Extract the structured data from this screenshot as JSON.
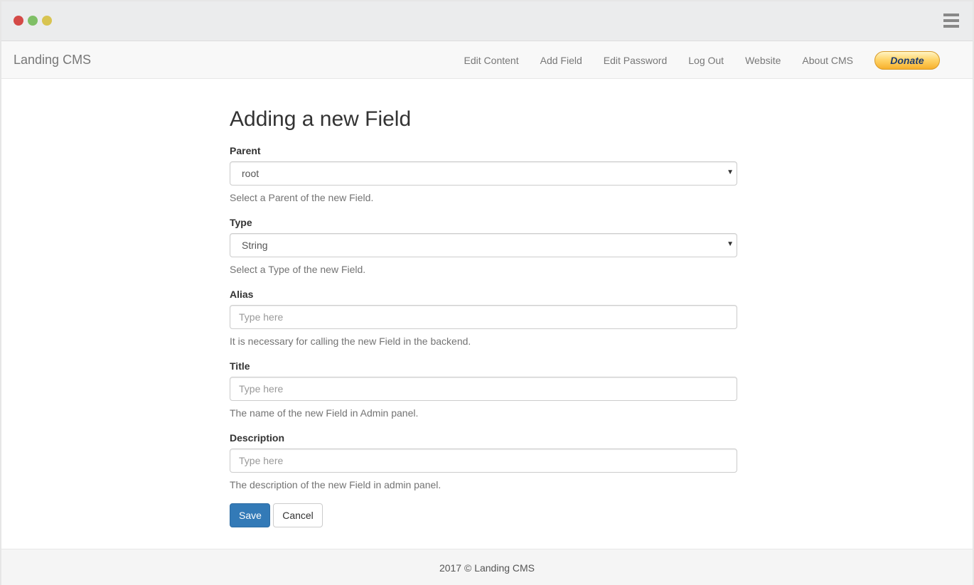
{
  "window": {
    "controls": [
      "close",
      "minimize",
      "maximize"
    ],
    "menu_icon": "hamburger-icon"
  },
  "navbar": {
    "brand": "Landing CMS",
    "items": [
      {
        "label": "Edit Content"
      },
      {
        "label": "Add Field"
      },
      {
        "label": "Edit Password"
      },
      {
        "label": "Log Out"
      },
      {
        "label": "Website"
      },
      {
        "label": "About CMS"
      }
    ],
    "donate_label": "Donate"
  },
  "form": {
    "heading": "Adding a new Field",
    "parent": {
      "label": "Parent",
      "value": "root",
      "help": "Select a Parent of the new Field."
    },
    "type": {
      "label": "Type",
      "value": "String",
      "help": "Select a Type of the new Field."
    },
    "alias": {
      "label": "Alias",
      "value": "",
      "placeholder": "Type here",
      "help": "It is necessary for calling the new Field in the backend."
    },
    "title": {
      "label": "Title",
      "value": "",
      "placeholder": "Type here",
      "help": "The name of the new Field in Admin panel."
    },
    "description": {
      "label": "Description",
      "value": "",
      "placeholder": "Type here",
      "help": "The description of the new Field in admin panel."
    },
    "save_label": "Save",
    "cancel_label": "Cancel"
  },
  "footer": {
    "text": "2017 © Landing CMS"
  },
  "colors": {
    "primary": "#337ab7",
    "navbar_bg": "#f8f8f8",
    "chrome_bg": "#ebeced",
    "close_dot": "#d44a47",
    "minimize_dot": "#7fbf66",
    "maximize_dot": "#d8c451"
  }
}
